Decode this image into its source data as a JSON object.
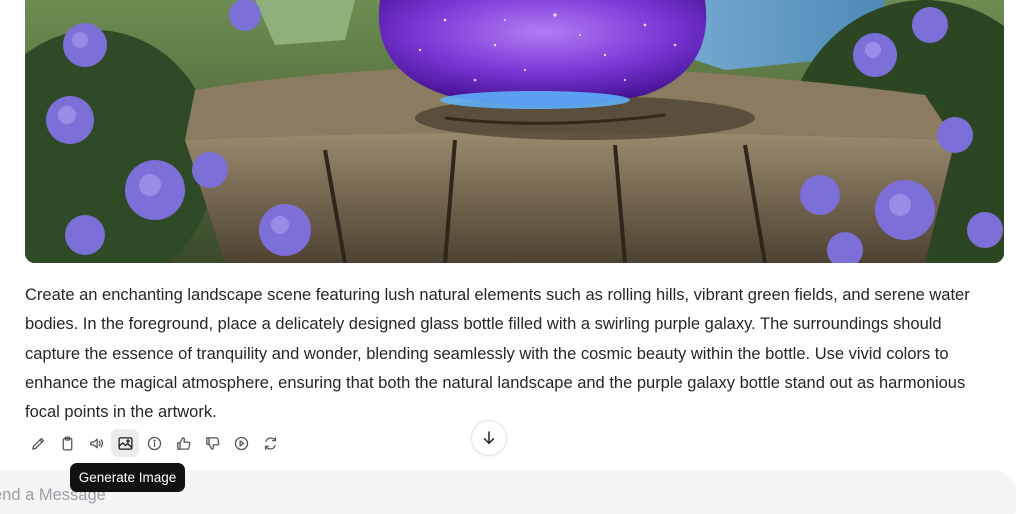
{
  "image": {
    "alt": ""
  },
  "message": {
    "text": "Create an enchanting landscape scene featuring lush natural elements such as rolling hills, vibrant green fields, and serene water bodies. In the foreground, place a delicately designed glass bottle filled with a swirling purple galaxy. The surroundings should capture the essence of tranquility and wonder, blending seamlessly with the cosmic beauty within the bottle. Use vivid colors to enhance the magical atmosphere, ensuring that both the natural landscape and the purple galaxy bottle stand out as harmonious focal points in the artwork."
  },
  "toolbar": {
    "buttons": [
      {
        "icon": "pencil-icon"
      },
      {
        "icon": "clipboard-icon"
      },
      {
        "icon": "speaker-icon"
      },
      {
        "icon": "image-icon",
        "active": true
      },
      {
        "icon": "info-icon"
      },
      {
        "icon": "thumbs-up-icon"
      },
      {
        "icon": "thumbs-down-icon"
      },
      {
        "icon": "play-icon"
      },
      {
        "icon": "refresh-icon"
      }
    ]
  },
  "tooltip": {
    "text": "Generate Image"
  },
  "scroll_button": {
    "icon": "arrow-down-icon"
  },
  "composer": {
    "placeholder": "Send a Message",
    "value": ""
  },
  "colors": {
    "tooltip_bg": "#111111",
    "active_button_bg": "#ececec",
    "composer_bg": "#f5f5f6"
  }
}
